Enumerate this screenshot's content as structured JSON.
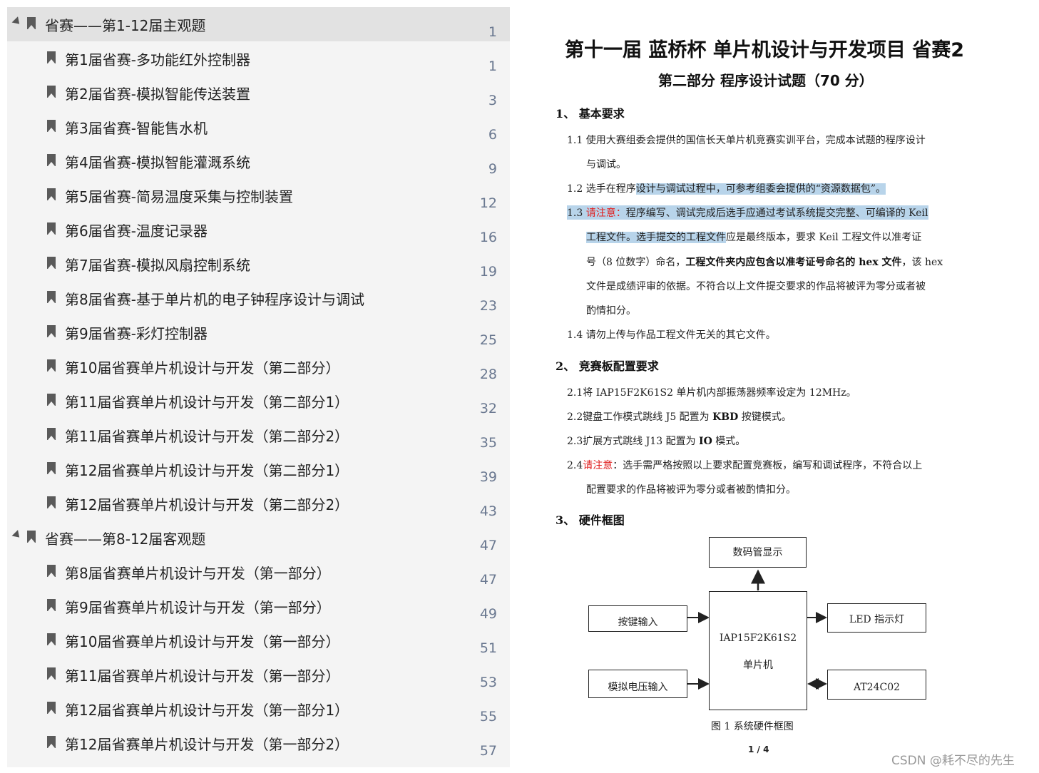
{
  "bookmarks": {
    "items": [
      {
        "label": "省赛——第1-12届主观题",
        "page": "1",
        "level": 0,
        "expanded": true,
        "selected": true
      },
      {
        "label": "第1届省赛-多功能红外控制器",
        "page": "1",
        "level": 1
      },
      {
        "label": "第2届省赛-模拟智能传送装置",
        "page": "3",
        "level": 1
      },
      {
        "label": "第3届省赛-智能售水机",
        "page": "6",
        "level": 1
      },
      {
        "label": "第4届省赛-模拟智能灌溉系统",
        "page": "9",
        "level": 1
      },
      {
        "label": "第5届省赛-简易温度采集与控制装置",
        "page": "12",
        "level": 1
      },
      {
        "label": "第6届省赛-温度记录器",
        "page": "16",
        "level": 1
      },
      {
        "label": "第7届省赛-模拟风扇控制系统",
        "page": "19",
        "level": 1
      },
      {
        "label": "第8届省赛-基于单片机的电子钟程序设计与调试",
        "page": "23",
        "level": 1
      },
      {
        "label": "第9届省赛-彩灯控制器",
        "page": "25",
        "level": 1
      },
      {
        "label": "第10届省赛单片机设计与开发（第二部分）",
        "page": "28",
        "level": 1
      },
      {
        "label": "第11届省赛单片机设计与开发（第二部分1）",
        "page": "32",
        "level": 1
      },
      {
        "label": "第11届省赛单片机设计与开发（第二部分2）",
        "page": "35",
        "level": 1
      },
      {
        "label": "第12届省赛单片机设计与开发（第二部分1）",
        "page": "39",
        "level": 1
      },
      {
        "label": "第12届省赛单片机设计与开发（第二部分2）",
        "page": "43",
        "level": 1
      },
      {
        "label": "省赛——第8-12届客观题",
        "page": "47",
        "level": 0,
        "expanded": true
      },
      {
        "label": "第8届省赛单片机设计与开发（第一部分）",
        "page": "47",
        "level": 1
      },
      {
        "label": "第9届省赛单片机设计与开发（第一部分）",
        "page": "49",
        "level": 1
      },
      {
        "label": "第10届省赛单片机设计与开发（第一部分）",
        "page": "51",
        "level": 1
      },
      {
        "label": "第11届省赛单片机设计与开发（第一部分）",
        "page": "53",
        "level": 1
      },
      {
        "label": "第12届省赛单片机设计与开发（第一部分1）",
        "page": "55",
        "level": 1
      },
      {
        "label": "第12届省赛单片机设计与开发（第一部分2）",
        "page": "57",
        "level": 1
      }
    ]
  },
  "document": {
    "title": "第十一届 蓝桥杯 单片机设计与开发项目 省赛2",
    "subtitle": "第二部分 程序设计试题（70 分）",
    "sec1": "1、 基本要求",
    "p11a": "1.1 使用大赛组委会提供的国信长天单片机竞赛实训平台，完成本试题的程序设计",
    "p11b": "与调试。",
    "p12_plain": "1.2 选手在程序",
    "p12_hl": "设计与调试过程中，可参考组委会提供的“资源数据包”。",
    "p13_num": "1.3 ",
    "p13_note": "请注意：",
    "p13_hl1": "程序编写、调试完成后选手应通过考试系统提交完整、可编译的 Keil",
    "p13_hl2": "工程文件。选手提交的工程文件",
    "p13_rest2": "应是最终版本，要求 Keil 工程文件以准考证",
    "p13_l3a": "号（8 位数字）命名，",
    "p13_l3b": "工程文件夹内应包含以准考证号命名的 hex 文件",
    "p13_l3c": "，该 hex",
    "p13_l4": "文件是成绩评审的依据。不符合以上文件提交要求的作品将被评为零分或者被",
    "p13_l5": "酌情扣分。",
    "p14": "1.4 请勿上传与作品工程文件无关的其它文件。",
    "sec2": "2、 竞赛板配置要求",
    "p21": "2.1将 IAP15F2K61S2 单片机内部振荡器频率设定为 12MHz。",
    "p22a": "2.2键盘工作模式跳线 J5 配置为 ",
    "p22b": "KBD",
    "p22c": " 按键模式。",
    "p23a": "2.3扩展方式跳线 J13 配置为 ",
    "p23b": "IO",
    "p23c": " 模式。",
    "p24_num": "2.4",
    "p24_note": "请注意",
    "p24_rest": "：选手需严格按照以上要求配置竞赛板，编写和调试程序，不符合以上",
    "p24b": "配置要求的作品将被评为零分或者被酌情扣分。",
    "sec3": "3、 硬件框图",
    "diagram": {
      "display": "数码管显示",
      "keys": "按键输入",
      "analog": "模拟电压输入",
      "mcu_line1": "IAP15F2K61S2",
      "mcu_line2": "单片机",
      "led": "LED 指示灯",
      "eeprom": "AT24C02"
    },
    "caption": "图 1 系统硬件框图",
    "page_indicator": "1 / 4"
  },
  "watermark": "CSDN @耗不尽的先生",
  "colors": {
    "highlight": "#b8d4ea",
    "note_red": "#e02020",
    "panel_bg": "#f4f4f4",
    "selected_bg": "#e2e2e2"
  }
}
